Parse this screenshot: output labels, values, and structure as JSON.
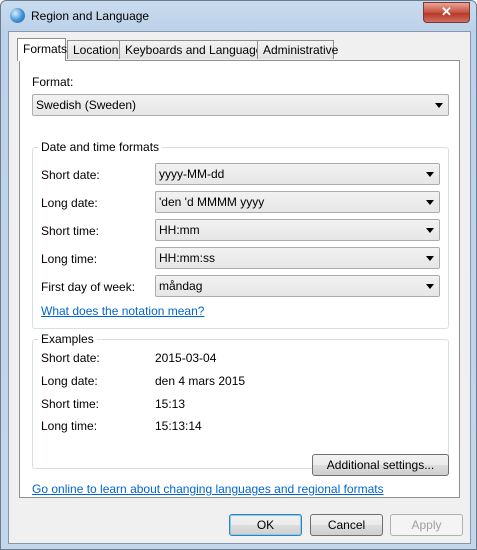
{
  "window": {
    "title": "Region and Language",
    "close_glyph": "✕"
  },
  "tabs": [
    {
      "label": "Formats"
    },
    {
      "label": "Location"
    },
    {
      "label": "Keyboards and Languages"
    },
    {
      "label": "Administrative"
    }
  ],
  "format": {
    "label": "Format:",
    "value": "Swedish (Sweden)"
  },
  "datetime_group": {
    "title": "Date and time formats",
    "fields": [
      {
        "label": "Short date:",
        "value": "yyyy-MM-dd"
      },
      {
        "label": "Long date:",
        "value": "'den 'd MMMM yyyy"
      },
      {
        "label": "Short time:",
        "value": "HH:mm"
      },
      {
        "label": "Long time:",
        "value": "HH:mm:ss"
      },
      {
        "label": "First day of week:",
        "value": "måndag"
      }
    ],
    "notation_link": "What does the notation mean?"
  },
  "examples": {
    "title": "Examples",
    "rows": [
      {
        "label": "Short date:",
        "value": "2015-03-04"
      },
      {
        "label": "Long date:",
        "value": "den 4 mars 2015"
      },
      {
        "label": "Short time:",
        "value": "15:13"
      },
      {
        "label": "Long time:",
        "value": "15:13:14"
      }
    ]
  },
  "additional_settings_label": "Additional settings...",
  "online_link": "Go online to learn about changing languages and regional formats",
  "buttons": {
    "ok": "OK",
    "cancel": "Cancel",
    "apply": "Apply"
  }
}
